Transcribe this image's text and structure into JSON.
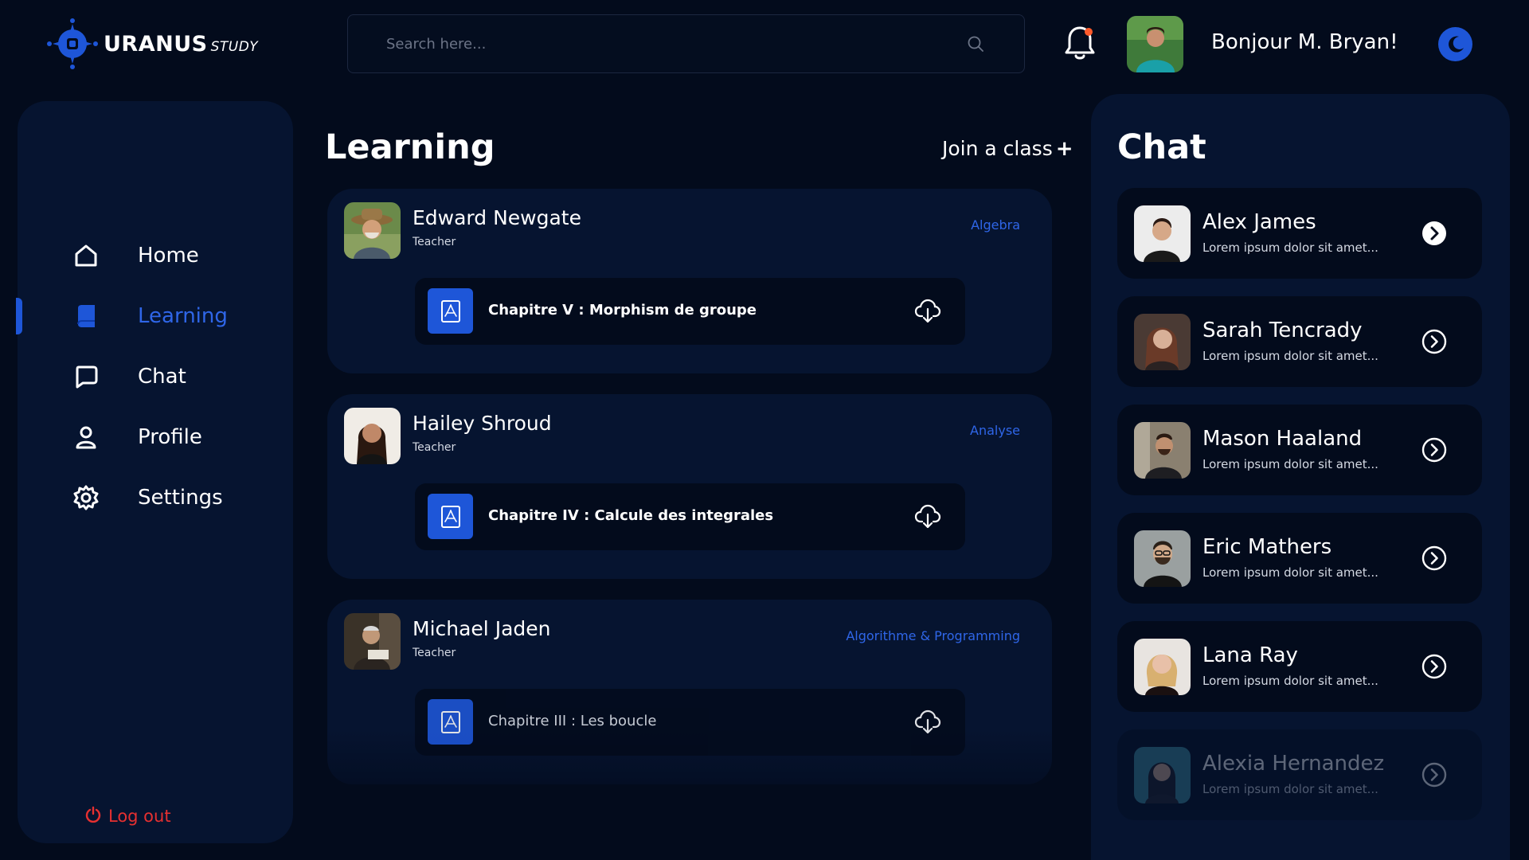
{
  "brand": {
    "name": "URANUS",
    "sub": "STUDY",
    "icon": "uranus-logo-icon"
  },
  "search": {
    "placeholder": "Search here...",
    "icon": "search-icon"
  },
  "header": {
    "greeting": "Bonjour M. Bryan!",
    "notification_icon": "bell-icon",
    "theme_icon": "moon-icon"
  },
  "sidebar": {
    "items": [
      {
        "label": "Home",
        "icon": "home-icon",
        "active": false
      },
      {
        "label": "Learning",
        "icon": "book-icon",
        "active": true
      },
      {
        "label": "Chat",
        "icon": "chat-bubble-icon",
        "active": false
      },
      {
        "label": "Profile",
        "icon": "user-icon",
        "active": false
      },
      {
        "label": "Settings",
        "icon": "gear-icon",
        "active": false
      }
    ],
    "logout_label": "Log out"
  },
  "learning": {
    "title": "Learning",
    "join_label": "Join a class",
    "join_symbol": "+",
    "courses": [
      {
        "teacher": "Edward Newgate",
        "role": "Teacher",
        "subject": "Algebra",
        "chapter": "Chapitre V : Morphism de groupe"
      },
      {
        "teacher": "Hailey Shroud",
        "role": "Teacher",
        "subject": "Analyse",
        "chapter": "Chapitre IV : Calcule des integrales"
      },
      {
        "teacher": "Michael Jaden",
        "role": "Teacher",
        "subject": "Algorithme & Programming",
        "chapter": "Chapitre III : Les boucle"
      }
    ]
  },
  "chat": {
    "title": "Chat",
    "conversations": [
      {
        "name": "Alex James",
        "preview": "Lorem ipsum dolor sit amet..."
      },
      {
        "name": "Sarah Tencrady",
        "preview": "Lorem ipsum dolor sit amet..."
      },
      {
        "name": "Mason Haaland",
        "preview": "Lorem ipsum dolor sit amet..."
      },
      {
        "name": "Eric Mathers",
        "preview": "Lorem ipsum dolor sit amet..."
      },
      {
        "name": "Lana Ray",
        "preview": "Lorem ipsum dolor sit amet..."
      },
      {
        "name": "Alexia Hernandez",
        "preview": "Lorem ipsum dolor sit amet..."
      }
    ]
  },
  "colors": {
    "background": "#030b1c",
    "panel": "#061430",
    "accent": "#1e56d8",
    "accent_text": "#2f66e8",
    "danger": "#e63030",
    "notification_dot": "#ff5a2b"
  }
}
